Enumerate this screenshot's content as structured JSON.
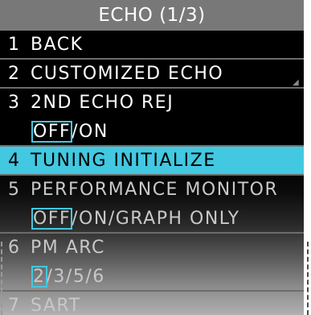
{
  "title": "ECHO (1/3)",
  "items": [
    {
      "num": "1",
      "label": "BACK"
    },
    {
      "num": "2",
      "label": "CUSTOMIZED ECHO"
    },
    {
      "num": "3",
      "label": "2ND ECHO REJ"
    },
    {
      "num": "4",
      "label": "TUNING INITIALIZE"
    },
    {
      "num": "5",
      "label": "PERFORMANCE MONITOR"
    },
    {
      "num": "6",
      "label": "PM ARC"
    },
    {
      "num": "7",
      "label": "SART"
    }
  ],
  "echo_rej_options": {
    "selected": "OFF",
    "sep": "/",
    "rest": "ON"
  },
  "performance_monitor_options": {
    "selected": "OFF",
    "sep1": "/",
    "rest": "ON/GRAPH ONLY"
  },
  "pm_arc_options": {
    "selected": "2",
    "rest": "/3/5/6"
  },
  "colors": {
    "title_bg": "#787878",
    "selected_bg": "#42c8e0",
    "text": "#ffffff",
    "dim_text": "#c8c8c8"
  }
}
